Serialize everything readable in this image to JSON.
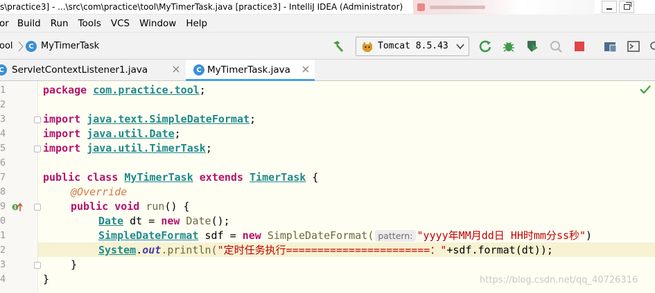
{
  "window": {
    "title": "s\\practice3] - ...\\src\\com\\practice\\tool\\MyTimerTask.java [practice3] - IntelliJ IDEA (Administrator)"
  },
  "menu": {
    "items": [
      "or",
      "Build",
      "Run",
      "Tools",
      "VCS",
      "Window",
      "Help"
    ]
  },
  "nav": {
    "crumb_parent": "ool",
    "crumb_current": "MyTimerTask",
    "class_badge": "C",
    "run_config": "Tomcat 8.5.43"
  },
  "tabs": [
    {
      "label": "ServletContextListener1.java",
      "active": false
    },
    {
      "label": "MyTimerTask.java",
      "active": true
    }
  ],
  "editor": {
    "line_numbers": [
      "1",
      "2",
      "3",
      "4",
      "5",
      "6",
      "7",
      "8",
      "9",
      "0",
      "1",
      "2",
      "3",
      "4"
    ],
    "lines": {
      "l1_kw": "package",
      "l1_pkg": "com.practice.tool",
      "l1_end": ";",
      "l3_kw": "import",
      "l3_pkg": "java.text.SimpleDateFormat",
      "l3_end": ";",
      "l4_kw": "import",
      "l4_pkg": "java.util.Date",
      "l4_end": ";",
      "l5_kw": "import",
      "l5_pkg": "java.util.TimerTask",
      "l5_end": ";",
      "l7_kw1": "public",
      "l7_kw2": "class",
      "l7_cls": "MyTimerTask",
      "l7_kw3": "extends",
      "l7_cls2": "TimerTask",
      "l7_end": " {",
      "l8_ann": "@Override",
      "l9_kw1": "public",
      "l9_kw2": "void",
      "l9_fn": "run",
      "l9_end": "() {",
      "l10_cls": "Date",
      "l10_mid": " dt = ",
      "l10_kw": "new",
      "l10_fn": " Date",
      "l10_end": "();",
      "l11_cls": "SimpleDateFormat",
      "l11_mid": " sdf = ",
      "l11_kw": "new",
      "l11_fn": " SimpleDateFormat(",
      "l11_hint": "pattern:",
      "l11_str": "\"yyyy年MM月dd日 HH时mm分ss秒\"",
      "l11_end": ")",
      "l12_cls": "System",
      "l12_dot": ".",
      "l12_fld": "out",
      "l12_fn": ".println(",
      "l12_str": "\"定时任务执行=======================：\"",
      "l12_end": "+sdf.format(dt));",
      "l13": "}",
      "l14": "}"
    }
  },
  "watermark": "https://blog.csdn.net/qq_40726316",
  "colors": {
    "keyword": "#b5126b",
    "type": "#1d8a8a",
    "annotation": "#cf7b42",
    "string": "#c00000",
    "tab_active_underline": "#4a9fe8",
    "editor_bg": "#fffef3"
  }
}
